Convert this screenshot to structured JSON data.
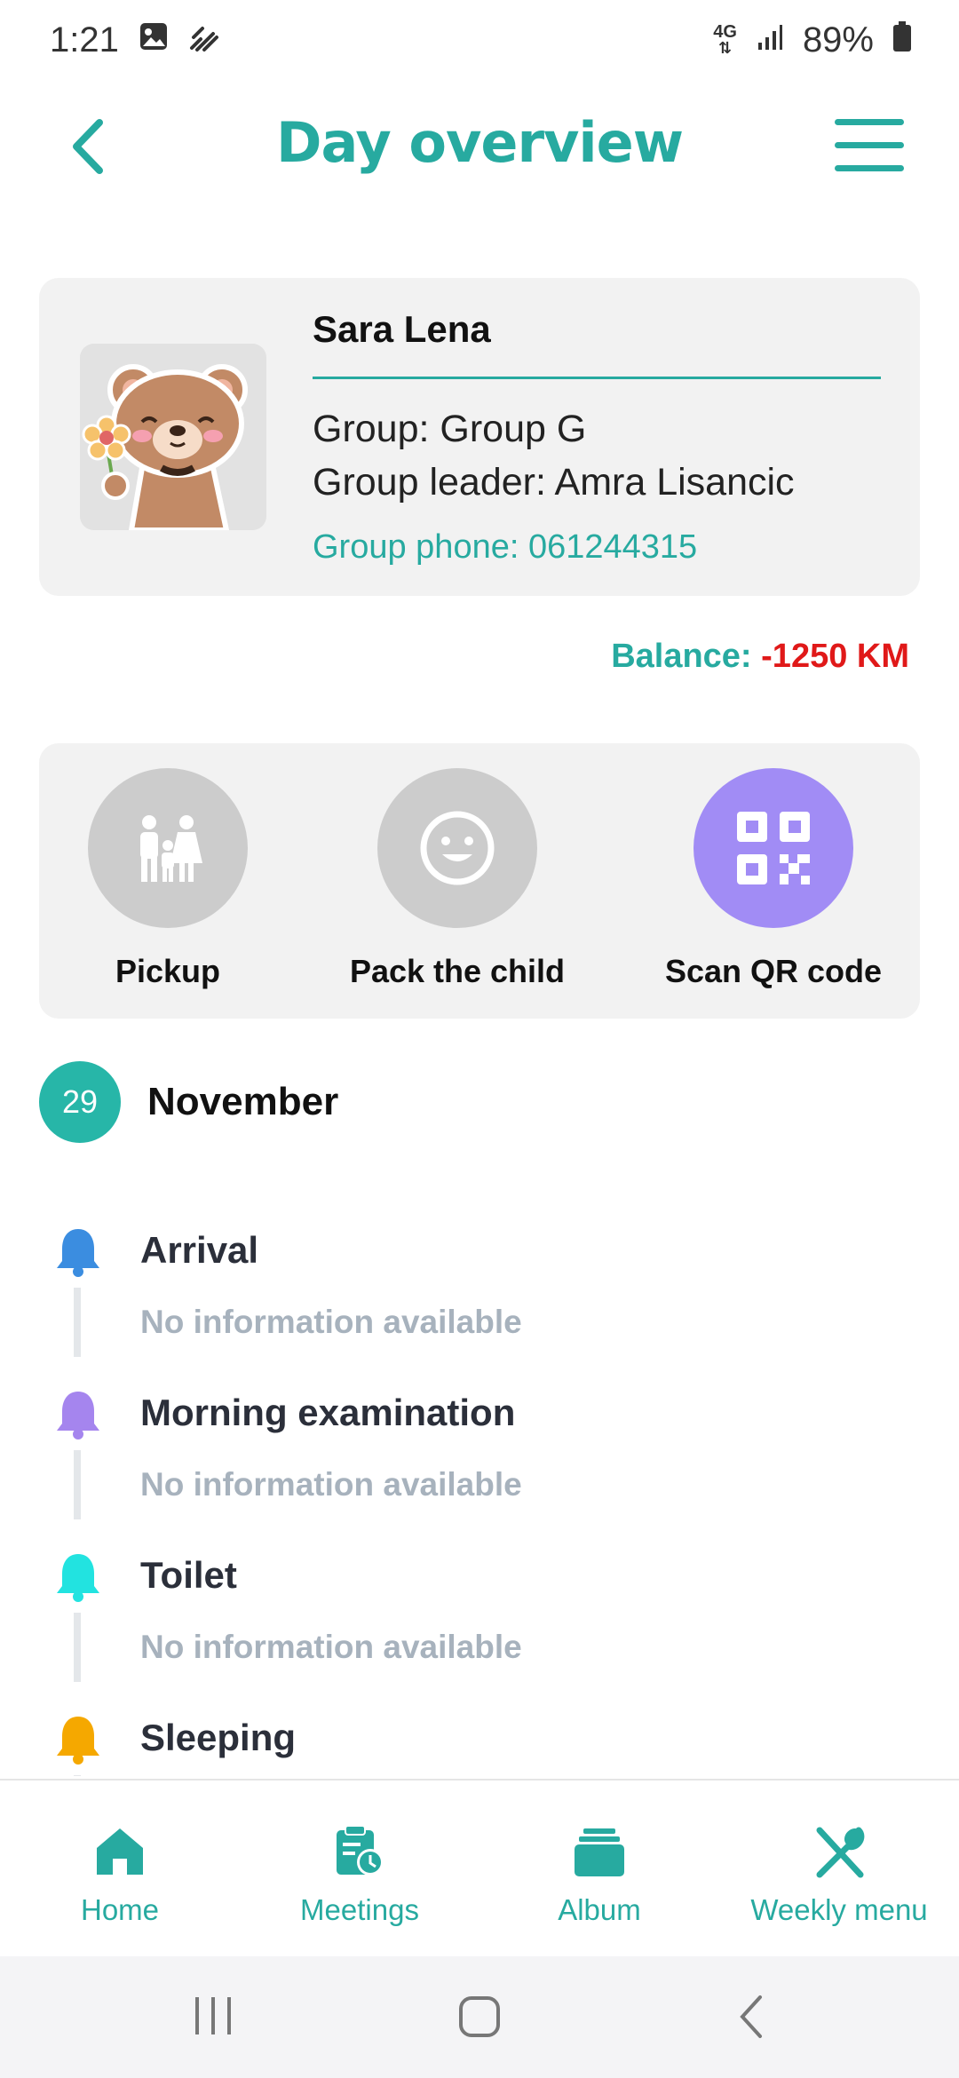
{
  "status_bar": {
    "time": "1:21",
    "network": "4G",
    "battery": "89%"
  },
  "header": {
    "title": "Day overview"
  },
  "profile": {
    "name": "Sara Lena",
    "group": "Group: Group G",
    "group_leader": "Group leader: Amra Lisancic",
    "group_phone": "Group phone: 061244315"
  },
  "balance": {
    "label": "Balance:",
    "amount": "-1250 KM"
  },
  "actions": [
    {
      "label": "Pickup",
      "icon": "family-icon",
      "color": "#cccccc"
    },
    {
      "label": "Pack the child",
      "icon": "smiley-icon",
      "color": "#cccccc"
    },
    {
      "label": "Scan QR code",
      "icon": "qr-code-icon",
      "color": "#a18cf5"
    }
  ],
  "date": {
    "day": "29",
    "month": "November"
  },
  "timeline": [
    {
      "title": "Arrival",
      "info": "No information available",
      "color": "#3b8de0"
    },
    {
      "title": "Morning examination",
      "info": "No information available",
      "color": "#a585ee"
    },
    {
      "title": "Toilet",
      "info": "No information available",
      "color": "#22e3e0"
    },
    {
      "title": "Sleeping",
      "info": "",
      "color": "#f5a800"
    }
  ],
  "bottom_nav": [
    {
      "label": "Home",
      "icon": "home-icon"
    },
    {
      "label": "Meetings",
      "icon": "meetings-icon"
    },
    {
      "label": "Album",
      "icon": "album-icon"
    },
    {
      "label": "Weekly menu",
      "icon": "cutlery-icon"
    }
  ],
  "colors": {
    "accent": "#27aaa0",
    "negative": "#e01919",
    "card_bg": "#f2f2f2"
  }
}
